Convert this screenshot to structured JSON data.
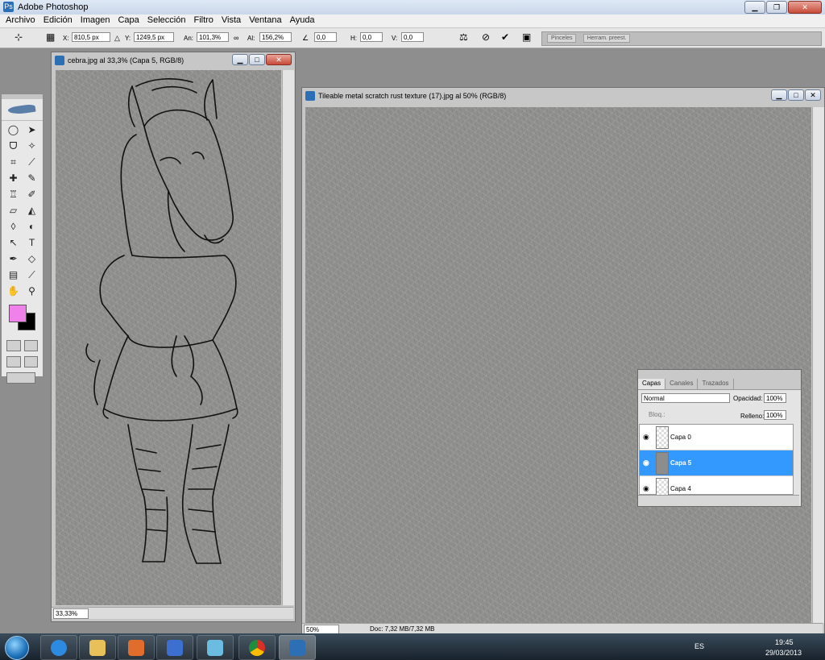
{
  "app": {
    "title": "Adobe Photoshop"
  },
  "menu": [
    "Archivo",
    "Edición",
    "Imagen",
    "Capa",
    "Selección",
    "Filtro",
    "Vista",
    "Ventana",
    "Ayuda"
  ],
  "options": {
    "x_label": "X:",
    "x_value": "810,5 px",
    "y_label": "Y:",
    "y_value": "1249,5 px",
    "w_label": "An:",
    "w_value": "101,3%",
    "h_label": "Al:",
    "h_value": "156,2%",
    "angle_value": "0,0",
    "hskew_label": "H:",
    "hskew_value": "0,0",
    "vskew_label": "V:",
    "vskew_value": "0,0",
    "well_tabs": [
      "Pinceles",
      "Herram. preest."
    ]
  },
  "doc1": {
    "title": "cebra.jpg al 33,3% (Capa 5, RGB/8)",
    "zoom": "33,33%"
  },
  "doc2": {
    "title": "Tileable metal scratch rust texture (17).jpg al 50% (RGB/8)",
    "zoom": "50%",
    "doc_info": "Doc: 7,32 MB/7,32 MB"
  },
  "toolbox": {
    "fg_color": "#f080ea",
    "bg_color": "#000000"
  },
  "layers_panel": {
    "tabs": [
      "Capas",
      "Canales",
      "Trazados"
    ],
    "blend_mode": "Normal",
    "opacity_label": "Opacidad:",
    "opacity": "100%",
    "lock_label": "Bloq.:",
    "fill_label": "Relleno:",
    "fill": "100%",
    "layers": [
      {
        "name": "Capa 0"
      },
      {
        "name": "Capa 5"
      },
      {
        "name": "Capa 4"
      }
    ]
  },
  "taskbar": {
    "lang": "ES",
    "time": "19:45",
    "date": "29/03/2013"
  }
}
